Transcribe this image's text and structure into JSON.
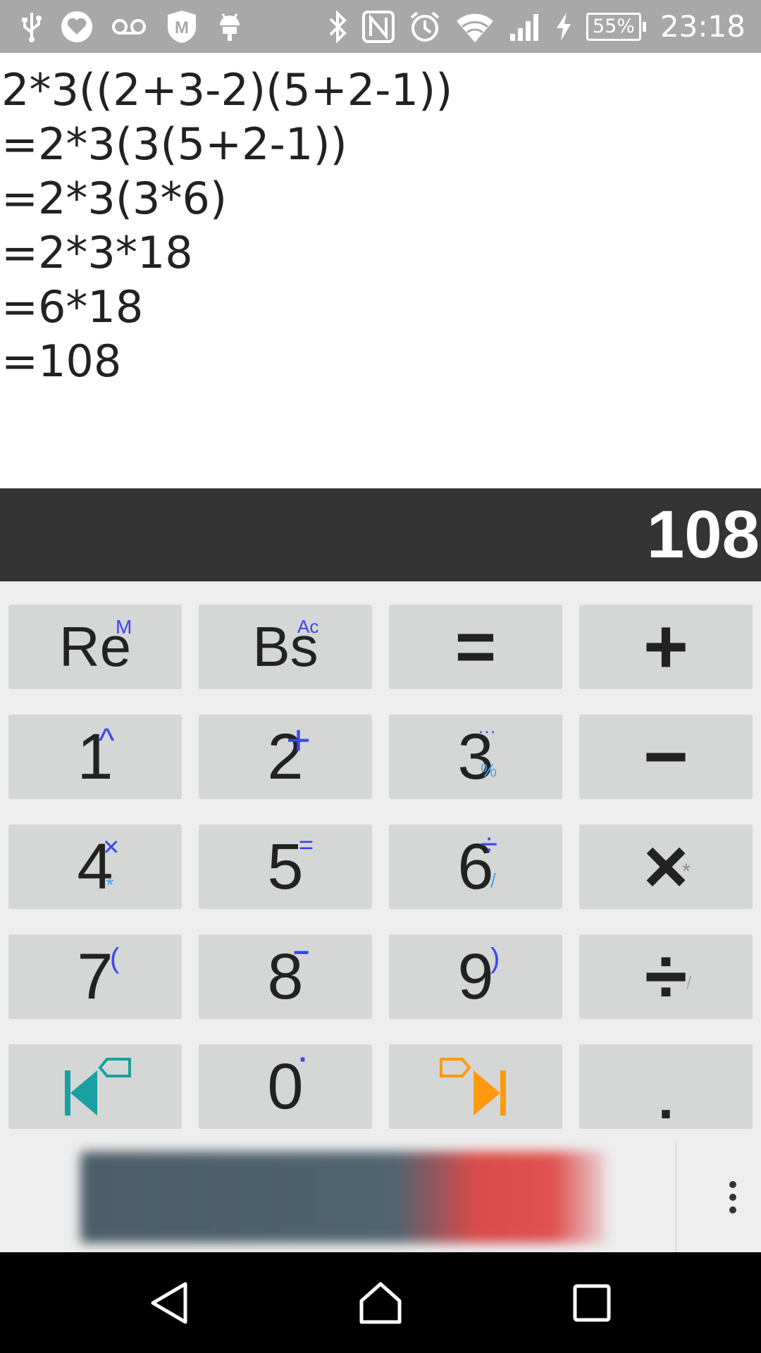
{
  "status_bar": {
    "time": "23:18",
    "battery": "55%",
    "icons": [
      "usb-icon",
      "heart-app-icon",
      "voicemail-icon",
      "mcafee-icon",
      "android-debug-icon",
      "bluetooth-icon",
      "nfc-icon",
      "alarm-icon",
      "wifi-icon",
      "signal-icon",
      "charging-icon",
      "battery-icon"
    ]
  },
  "history": {
    "lines": [
      "2*3((2+3-2)(5+2-1))",
      "=2*3(3(5+2-1))",
      "=2*3(3*6)",
      "=2*3*18",
      "=6*18",
      "=108"
    ]
  },
  "result": {
    "value": "108"
  },
  "keypad": {
    "keys": [
      {
        "name": "key-re",
        "main": "Re",
        "sup": "M"
      },
      {
        "name": "key-bs",
        "main": "Bs",
        "sup": "Ac"
      },
      {
        "name": "key-equals",
        "main": "="
      },
      {
        "name": "key-plus",
        "main": "+"
      },
      {
        "name": "key-1",
        "main": "1",
        "sup": "^"
      },
      {
        "name": "key-2",
        "main": "2",
        "sup": "+"
      },
      {
        "name": "key-3",
        "main": "3",
        "sup": "···",
        "sub": "%"
      },
      {
        "name": "key-minus",
        "main": "−"
      },
      {
        "name": "key-4",
        "main": "4",
        "sup": "×",
        "sub": "*"
      },
      {
        "name": "key-5",
        "main": "5",
        "sup": "="
      },
      {
        "name": "key-6",
        "main": "6",
        "sup": "÷",
        "sub": "/"
      },
      {
        "name": "key-times",
        "main": "×",
        "sub": "*"
      },
      {
        "name": "key-7",
        "main": "7",
        "sup": "("
      },
      {
        "name": "key-8",
        "main": "8",
        "sup": "−"
      },
      {
        "name": "key-9",
        "main": "9",
        "sup": ")"
      },
      {
        "name": "key-divide",
        "main": "÷",
        "sub": "/"
      },
      {
        "name": "key-cursor-left",
        "icon": "cursor-start-icon"
      },
      {
        "name": "key-0",
        "main": "0",
        "sup": "·"
      },
      {
        "name": "key-cursor-right",
        "icon": "cursor-end-icon"
      },
      {
        "name": "key-decimal",
        "main": "."
      }
    ]
  },
  "colors": {
    "result_bg": "#343434",
    "key_bg": "#d5d6d6",
    "keypad_bg": "#eeeeee",
    "sup_blue": "#3b46f0",
    "sub_blue": "#4aa3ea",
    "teal": "#1aa0a0",
    "orange": "#ff9a10"
  },
  "nav": {
    "icons": [
      "back-icon",
      "home-icon",
      "recents-icon"
    ]
  }
}
